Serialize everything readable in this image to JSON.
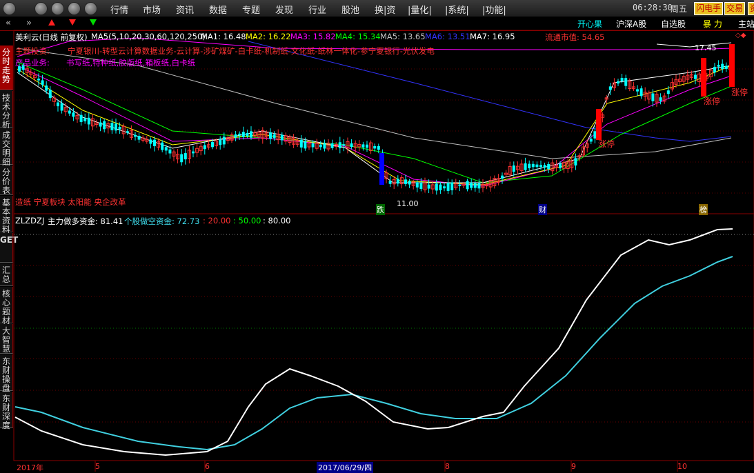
{
  "menu": {
    "items": [
      "行情",
      "市场",
      "资讯",
      "数据",
      "专题",
      "发现",
      "行业",
      "股池",
      "换|资",
      "|量化|",
      "|系统|",
      "|功能|"
    ],
    "time": "06:28:30",
    "weekday": "周五",
    "btn_flash": "闪电手",
    "btn_trade": "交易",
    "btn_cut": "资"
  },
  "toolbar": {
    "nav_left": "«",
    "nav_right": "»",
    "right_items": [
      "开心果",
      "沪深A股",
      "自选股",
      "暴 力",
      "主站"
    ]
  },
  "left_tabs": [
    "分时走势",
    "技术分析",
    "成交明细",
    "分价表",
    "基本资料",
    "GET",
    "汇总",
    "核心题材",
    "大智慧",
    "东财操盘",
    "东财深度"
  ],
  "kline": {
    "title": "美利云(日线 前复权)",
    "ma_params": "MA5(5,10,20,30,60,120,250)",
    "ma_values": [
      {
        "label": "MA1: 16.48",
        "color": "#ffffff"
      },
      {
        "label": "MA2: 16.22",
        "color": "#ffff00"
      },
      {
        "label": "MA3: 15.82",
        "color": "#ff00ff"
      },
      {
        "label": "MA4: 15.34",
        "color": "#00ff00"
      },
      {
        "label": "MA5: 13.65",
        "color": "#c0c0c0"
      },
      {
        "label": "MA6: 13.51",
        "color": "#3333ff"
      },
      {
        "label": "MA7: 16.95",
        "color": "#ffffff"
      }
    ],
    "market_value": "流通市值: 54.65",
    "theme_label": "主题投资:",
    "theme_text": "宁夏银川-转型云计算数据业务-云计算-涉矿煤矿-白卡纸-机制纸-文化纸-纸林一体化-参宁夏银行-光伏发电",
    "product_label": "产品业务:",
    "product_text": "书写纸,特种纸,胶版纸,箱板纸,白卡纸",
    "concepts": "造纸 宁夏板块 太阳能 央企改革",
    "price_high": "17.45",
    "price_low": "11.00",
    "limit_up": [
      "涨停",
      "涨停",
      "涨停"
    ],
    "markers": [
      "跌",
      "财",
      "榜"
    ],
    "colors": {
      "up": "#ff3232",
      "down": "#00ffff",
      "bg": "#000000"
    }
  },
  "indicator": {
    "name": "ZLZDZJ",
    "main_label": "主力做多资金: 81.41",
    "sub_label": "个股做空资金: 72.73",
    "levels": ": 20.00 : 50.00 : 80.00",
    "level_20": ": 20.00",
    "level_50": ": 50.00",
    "level_80": ": 80.00"
  },
  "x_axis": {
    "labels": [
      "2017年",
      "5",
      "6",
      "2017/06/29/四",
      "8",
      "9",
      "10"
    ]
  }
}
